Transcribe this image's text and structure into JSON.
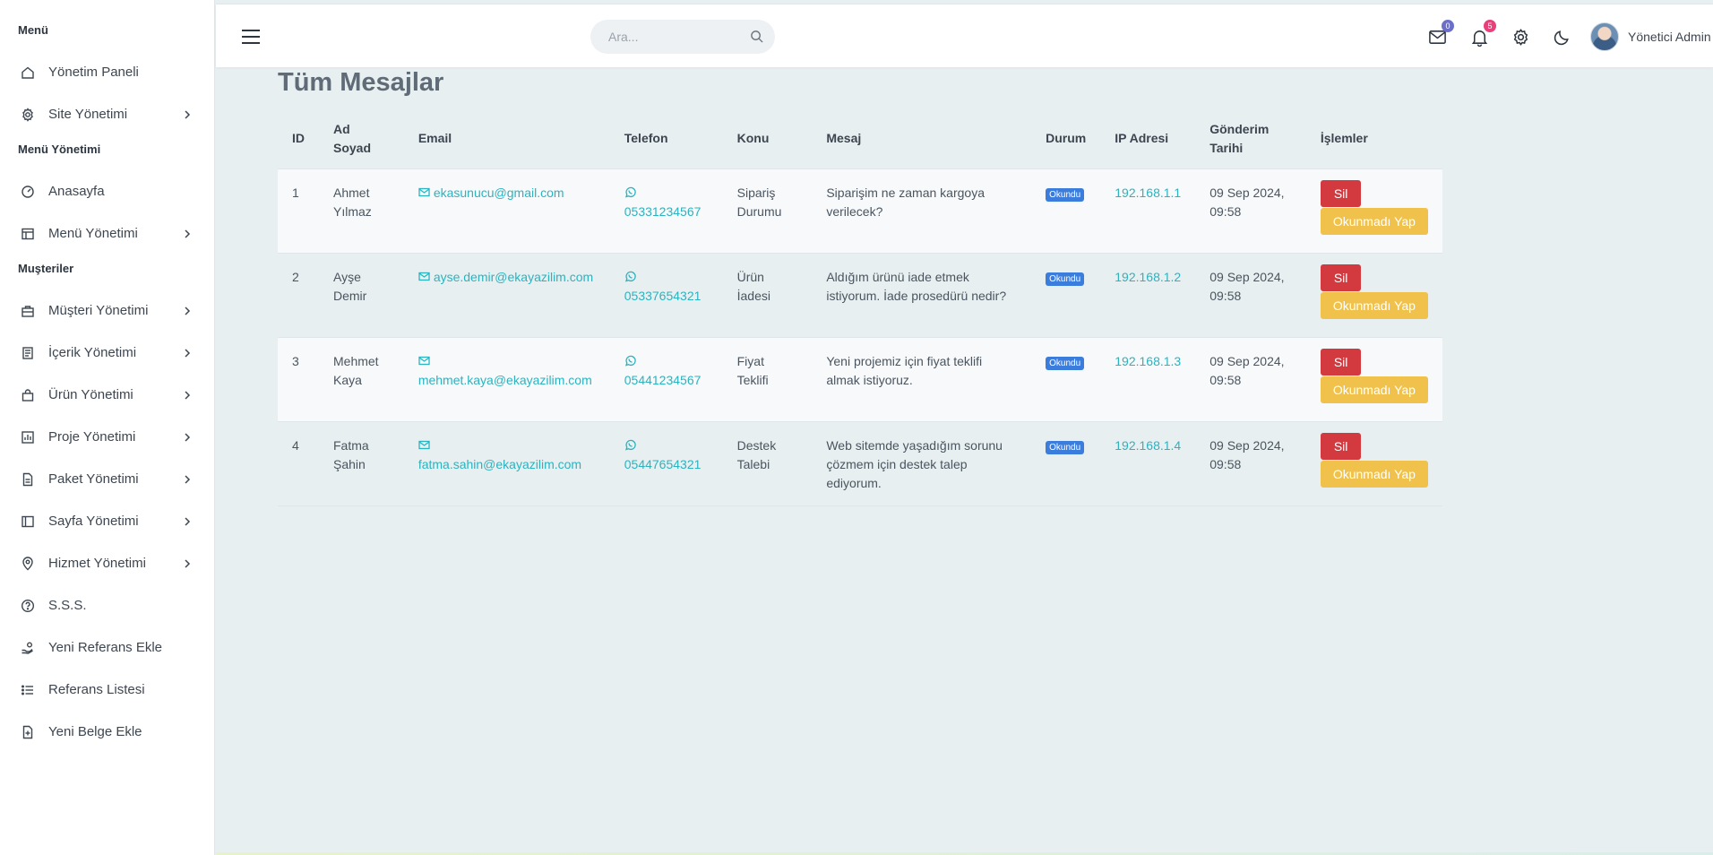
{
  "sidebar": {
    "sections": [
      {
        "title": "Menü",
        "items": [
          {
            "label": "Yönetim Paneli",
            "icon": "home-icon",
            "has_children": false
          },
          {
            "label": "Site Yönetimi",
            "icon": "gear-icon",
            "has_children": true
          }
        ]
      },
      {
        "title": "Menü Yönetimi",
        "items": [
          {
            "label": "Anasayfa",
            "icon": "dashboard-icon",
            "has_children": false
          },
          {
            "label": "Menü Yönetimi",
            "icon": "layout-icon",
            "has_children": true
          }
        ]
      },
      {
        "title": "Muşteriler",
        "items": [
          {
            "label": "Müşteri Yönetimi",
            "icon": "briefcase-icon",
            "has_children": true
          },
          {
            "label": "İçerik Yönetimi",
            "icon": "content-icon",
            "has_children": true
          },
          {
            "label": "Ürün Yönetimi",
            "icon": "shopping-bag-icon",
            "has_children": true
          },
          {
            "label": "Proje Yönetimi",
            "icon": "bar-chart-icon",
            "has_children": true
          },
          {
            "label": "Paket Yönetimi",
            "icon": "document-icon",
            "has_children": true
          },
          {
            "label": "Sayfa Yönetimi",
            "icon": "sidebar-layout-icon",
            "has_children": true
          },
          {
            "label": "Hizmet Yönetimi",
            "icon": "location-pin-icon",
            "has_children": true
          },
          {
            "label": "S.S.S.",
            "icon": "question-icon",
            "has_children": false
          },
          {
            "label": "Yeni Referans Ekle",
            "icon": "hand-coin-icon",
            "has_children": false
          },
          {
            "label": "Referans Listesi",
            "icon": "list-icon",
            "has_children": false
          },
          {
            "label": "Yeni Belge Ekle",
            "icon": "file-plus-icon",
            "has_children": false
          }
        ]
      }
    ]
  },
  "topbar": {
    "search_placeholder": "Ara...",
    "messages_badge": "0",
    "notifications_badge": "5",
    "user_name": "Yönetici Admin",
    "colors": {
      "messages_badge": "#6c6fc9",
      "notifications_badge": "#e8407a"
    }
  },
  "main": {
    "title": "Tüm Mesajlar",
    "columns": [
      "ID",
      "Ad Soyad",
      "Email",
      "Telefon",
      "Konu",
      "Mesaj",
      "Durum",
      "IP Adresi",
      "Gönderim Tarihi",
      "İşlemler"
    ],
    "delete_label": "Sil",
    "mark_unread_label": "Okunmadı Yap",
    "rows": [
      {
        "id": "1",
        "name": "Ahmet Yılmaz",
        "email": "ekasunucu@gmail.com",
        "phone": "05331234567",
        "subject": "Sipariş Durumu",
        "message": "Siparişim ne zaman kargoya verilecek?",
        "status": "Okundu",
        "ip": "192.168.1.1",
        "date": "09 Sep 2024, 09:58"
      },
      {
        "id": "2",
        "name": "Ayşe Demir",
        "email": "ayse.demir@ekayazilim.com",
        "phone": "05337654321",
        "subject": "Ürün İadesi",
        "message": "Aldığım ürünü iade etmek istiyorum. İade prosedürü nedir?",
        "status": "Okundu",
        "ip": "192.168.1.2",
        "date": "09 Sep 2024, 09:58"
      },
      {
        "id": "3",
        "name": "Mehmet Kaya",
        "email": "mehmet.kaya@ekayazilim.com",
        "phone": "05441234567",
        "subject": "Fiyat Teklifi",
        "message": "Yeni projemiz için fiyat teklifi almak istiyoruz.",
        "status": "Okundu",
        "ip": "192.168.1.3",
        "date": "09 Sep 2024, 09:58"
      },
      {
        "id": "4",
        "name": "Fatma Şahin",
        "email": "fatma.sahin@ekayazilim.com",
        "phone": "05447654321",
        "subject": "Destek Talebi",
        "message": "Web sitemde yaşadığım sorunu çözmem için destek talep ediyorum.",
        "status": "Okundu",
        "ip": "192.168.1.4",
        "date": "09 Sep 2024, 09:58"
      }
    ]
  }
}
